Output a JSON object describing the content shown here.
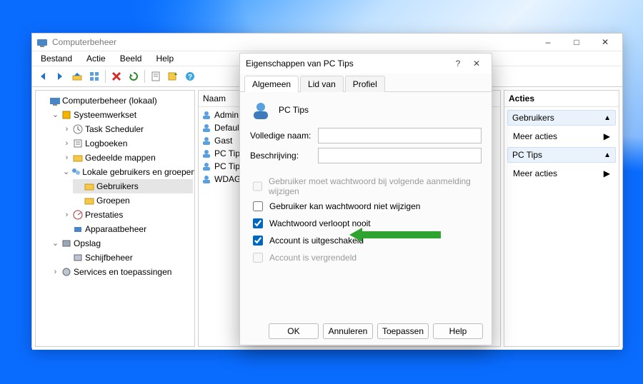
{
  "window": {
    "title": "Computerbeheer",
    "menus": [
      "Bestand",
      "Actie",
      "Beeld",
      "Help"
    ],
    "win_controls": {
      "min": "–",
      "max": "□",
      "close": "✕"
    }
  },
  "toolbar_icons": [
    "back-icon",
    "forward-icon",
    "up-icon",
    "grid-icon",
    "delete-icon",
    "refresh-icon",
    "properties-icon",
    "export-icon",
    "help-icon"
  ],
  "tree": {
    "root": "Computerbeheer (lokaal)",
    "systeemwerkset": "Systeemwerkset",
    "task_scheduler": "Task Scheduler",
    "logboeken": "Logboeken",
    "gedeelde_mappen": "Gedeelde mappen",
    "lokale_groepen": "Lokale gebruikers en groepen",
    "gebruikers": "Gebruikers",
    "groepen": "Groepen",
    "prestaties": "Prestaties",
    "apparaatbeheer": "Apparaatbeheer",
    "opslag": "Opslag",
    "schijfbeheer": "Schijfbeheer",
    "services": "Services en toepassingen"
  },
  "list": {
    "header": "Naam",
    "items": [
      "Admin",
      "Defaul",
      "Gast",
      "PC Tips",
      "PC Tips",
      "WDAG"
    ]
  },
  "actions": {
    "title": "Acties",
    "group1": "Gebruikers",
    "more1": "Meer acties",
    "group2": "PC Tips",
    "more2": "Meer acties"
  },
  "modal": {
    "title": "Eigenschappen van PC Tips",
    "help": "?",
    "close": "✕",
    "tabs": [
      "Algemeen",
      "Lid van",
      "Profiel"
    ],
    "active_tab": 0,
    "user_name": "PC Tips",
    "labels": {
      "full_name": "Volledige naam:",
      "description": "Beschrijving:"
    },
    "values": {
      "full_name": "",
      "description": ""
    },
    "checks": {
      "must_change": {
        "label": "Gebruiker moet wachtwoord bij volgende aanmelding wijzigen",
        "checked": false,
        "disabled": true
      },
      "cannot_change": {
        "label": "Gebruiker kan wachtwoord niet wijzigen",
        "checked": false,
        "disabled": false
      },
      "never_expires": {
        "label": "Wachtwoord verloopt nooit",
        "checked": true,
        "disabled": false
      },
      "disabled_acct": {
        "label": "Account is uitgeschakeld",
        "checked": true,
        "disabled": false
      },
      "locked": {
        "label": "Account is vergrendeld",
        "checked": false,
        "disabled": true
      }
    },
    "buttons": {
      "ok": "OK",
      "cancel": "Annuleren",
      "apply": "Toepassen",
      "help": "Help"
    }
  }
}
